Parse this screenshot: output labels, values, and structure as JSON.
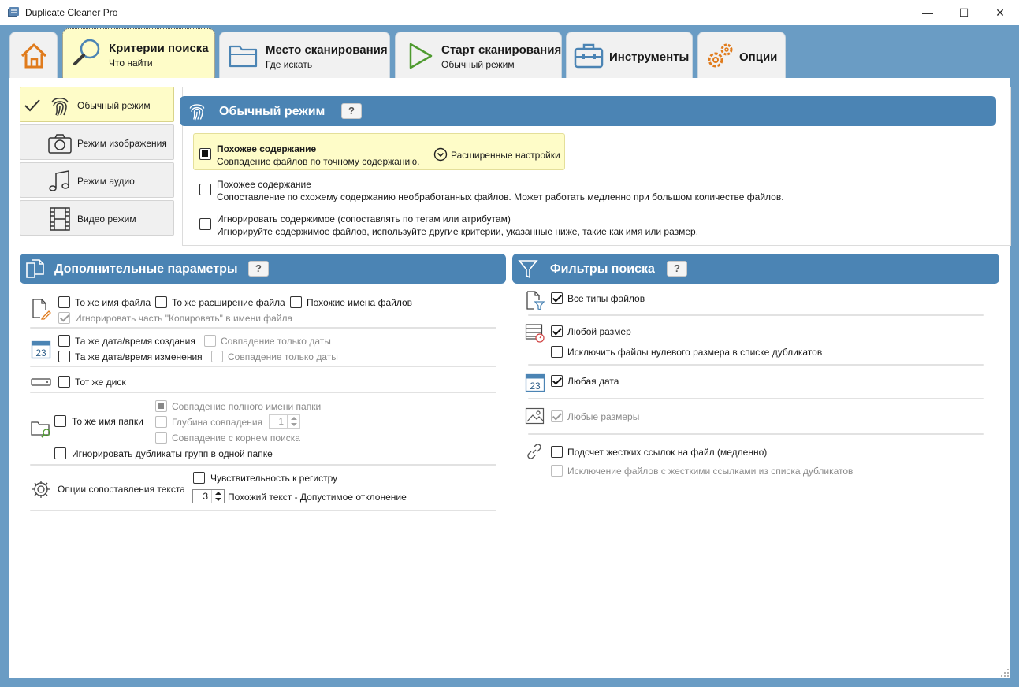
{
  "window": {
    "title": "Duplicate Cleaner Pro",
    "minimize": "—",
    "maximize": "☐",
    "close": "✕"
  },
  "tabs": [
    {
      "icon": "home-icon"
    },
    {
      "label": "Критерии поиска",
      "sub": "Что найти",
      "icon": "search-icon"
    },
    {
      "label": "Место сканирования",
      "sub": "Где искать",
      "icon": "folder-icon"
    },
    {
      "label": "Старт сканирования",
      "sub": "Обычный режим",
      "icon": "play-icon"
    },
    {
      "label": "Инструменты",
      "icon": "toolbox-icon"
    },
    {
      "label": "Опции",
      "icon": "gears-icon"
    }
  ],
  "modes": [
    {
      "label": "Обычный режим",
      "icon": "fingerprint-icon"
    },
    {
      "label": "Режим изображения",
      "icon": "camera-icon"
    },
    {
      "label": "Режим аудио",
      "icon": "music-icon"
    },
    {
      "label": "Видео режим",
      "icon": "film-icon"
    }
  ],
  "mode_panel": {
    "title": "Обычный режим",
    "help": "?",
    "options": [
      {
        "title": "Похожее содержание",
        "desc": "Совпадение файлов по точному содержанию."
      },
      {
        "title": "Похожее содержание",
        "desc": "Сопоставление по схожему содержанию необработанных файлов. Может работать медленно при большом количестве файлов."
      },
      {
        "title": "Игнорировать содержимое (сопоставлять по тегам или атрибутам)",
        "desc": "Игнорируйте содержимое файлов, используйте другие критерии, указанные ниже, такие как имя или размер."
      }
    ],
    "advanced": "Расширенные настройки"
  },
  "extra": {
    "title": "Дополнительные параметры",
    "help": "?",
    "same_name": "То же имя файла",
    "same_ext": "То же расширение файла",
    "similar_names": "Похожие имена файлов",
    "ignore_copy": "Игнорировать часть \"Копировать\" в имени файла",
    "same_created": "Та же дата/время создания",
    "date_only_1": "Совпадение только даты",
    "same_modified": "Та же дата/время изменения",
    "date_only_2": "Совпадение только даты",
    "same_disk": "Тот же диск",
    "same_folder": "То же имя папки",
    "full_folder": "Совпадение полного имени папки",
    "depth": "Глубина совпадения",
    "depth_value": "1",
    "root_match": "Совпадение с корнем поиска",
    "ignore_group": "Игнорировать дубликаты групп в одной папке",
    "text_options": "Опции сопоставления текста",
    "case": "Чувствительность к регистру",
    "tolerance_value": "3",
    "tolerance": "Похожий текст - Допустимое отклонение",
    "calendar_day": "23"
  },
  "filters": {
    "title": "Фильтры поиска",
    "help": "?",
    "all_types": "Все типы файлов",
    "any_size": "Любой размер",
    "exclude_zero": "Исключить файлы нулевого размера в списке дубликатов",
    "any_date": "Любая дата",
    "any_dims": "Любые размеры",
    "hardlinks": "Подсчет жестких ссылок на файл (медленно)",
    "exclude_hardlinks": "Исключение файлов с жесткими ссылками из списка дубликатов",
    "calendar_day": "23"
  }
}
